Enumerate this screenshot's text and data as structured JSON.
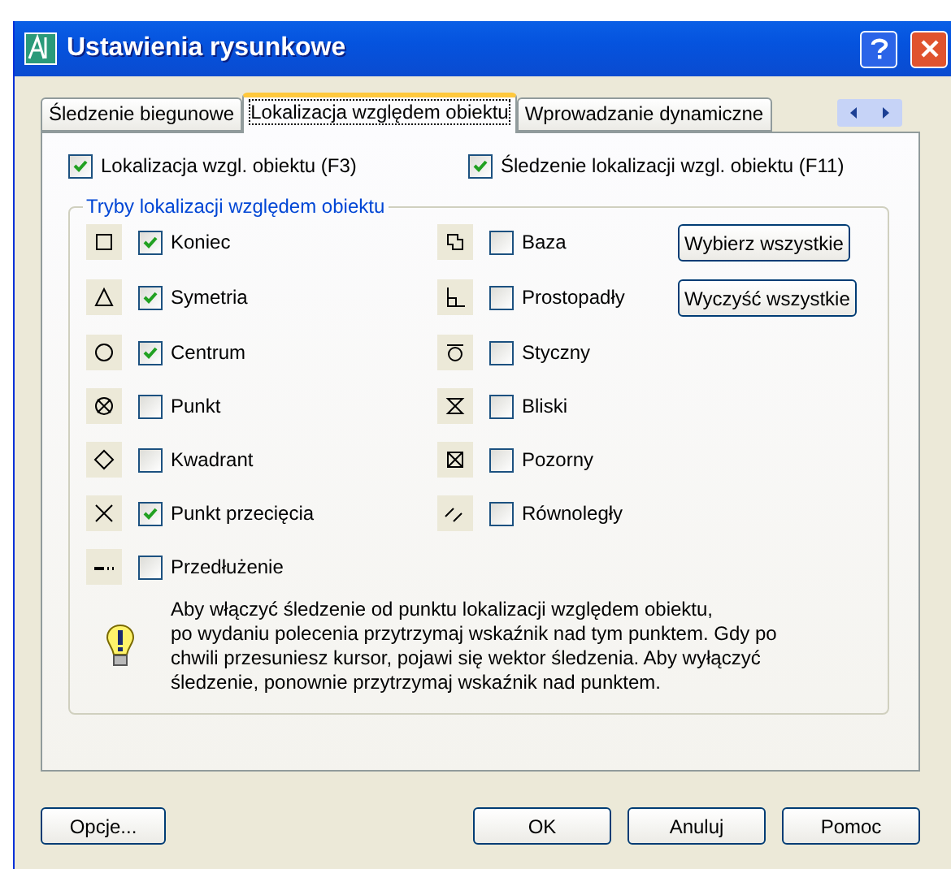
{
  "window": {
    "title": "Ustawienia rysunkowe"
  },
  "tabs": [
    {
      "label": "Śledzenie biegunowe",
      "selected": false
    },
    {
      "label": "Lokalizacja względem obiektu",
      "selected": true
    },
    {
      "label": "Wprowadzanie dynamiczne",
      "selected": false
    }
  ],
  "top_options": [
    {
      "label": "Lokalizacja wzgl. obiektu (F3)",
      "checked": true
    },
    {
      "label": "Śledzenie lokalizacji wzgl. obiektu (F11)",
      "checked": true
    }
  ],
  "modes_group": {
    "title": "Tryby lokalizacji względem obiektu",
    "left_column": [
      {
        "kind": "endpoint",
        "label": "Koniec",
        "checked": true
      },
      {
        "kind": "midpoint",
        "label": "Symetria",
        "checked": true
      },
      {
        "kind": "center",
        "label": "Centrum",
        "checked": true
      },
      {
        "kind": "node",
        "label": "Punkt",
        "checked": false
      },
      {
        "kind": "quadrant",
        "label": "Kwadrant",
        "checked": false
      },
      {
        "kind": "intersection",
        "label": "Punkt przecięcia",
        "checked": true
      },
      {
        "kind": "extension",
        "label": "Przedłużenie",
        "checked": false
      }
    ],
    "right_column": [
      {
        "kind": "insertion",
        "label": "Baza",
        "checked": false
      },
      {
        "kind": "perpendicular",
        "label": "Prostopadły",
        "checked": false
      },
      {
        "kind": "tangent",
        "label": "Styczny",
        "checked": false
      },
      {
        "kind": "nearest",
        "label": "Bliski",
        "checked": false
      },
      {
        "kind": "apparent",
        "label": "Pozorny",
        "checked": false
      },
      {
        "kind": "parallel",
        "label": "Równoległy",
        "checked": false
      }
    ],
    "buttons": [
      "Wybierz wszystkie",
      "Wyczyść wszystkie"
    ]
  },
  "tip": "Aby włączyć śledzenie od punktu lokalizacji względem obiektu,\npo wydaniu polecenia przytrzymaj wskaźnik nad tym punktem. Gdy po\nchwili przesuniesz kursor, pojawi się wektor śledzenia. Aby wyłączyć\nśledzenie, ponownie przytrzymaj wskaźnik nad punktem.",
  "footer": {
    "left_button": "Opcje...",
    "buttons": [
      "OK",
      "Anuluj",
      "Pomoc"
    ]
  }
}
